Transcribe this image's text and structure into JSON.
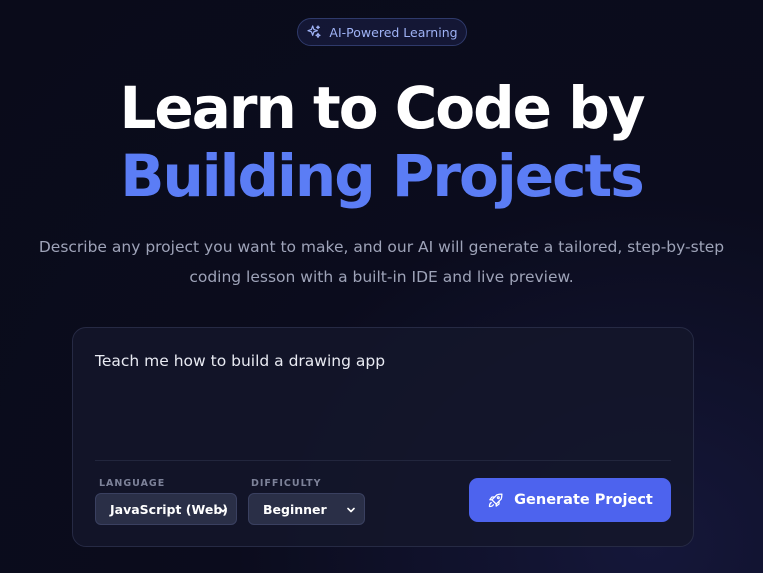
{
  "badge": {
    "label": "AI-Powered Learning"
  },
  "hero": {
    "line1": "Learn to Code by",
    "line2": "Building Projects",
    "description": "Describe any project you want to make, and our AI will generate a tailored, step-by-step coding lesson with a built-in IDE and live preview."
  },
  "form": {
    "prompt_value": "Teach me how to build a drawing app",
    "language_label": "LANGUAGE",
    "language_value": "JavaScript (Web)",
    "difficulty_label": "DIFFICULTY",
    "difficulty_value": "Beginner",
    "generate_label": "Generate Project"
  },
  "icons": {
    "badge": "sparkles-icon",
    "generate": "rocket-icon",
    "select": "chevron-down-icon"
  },
  "colors": {
    "accent": "#5b7df5",
    "button": "#4d63ee",
    "background": "#0b0c1d"
  }
}
